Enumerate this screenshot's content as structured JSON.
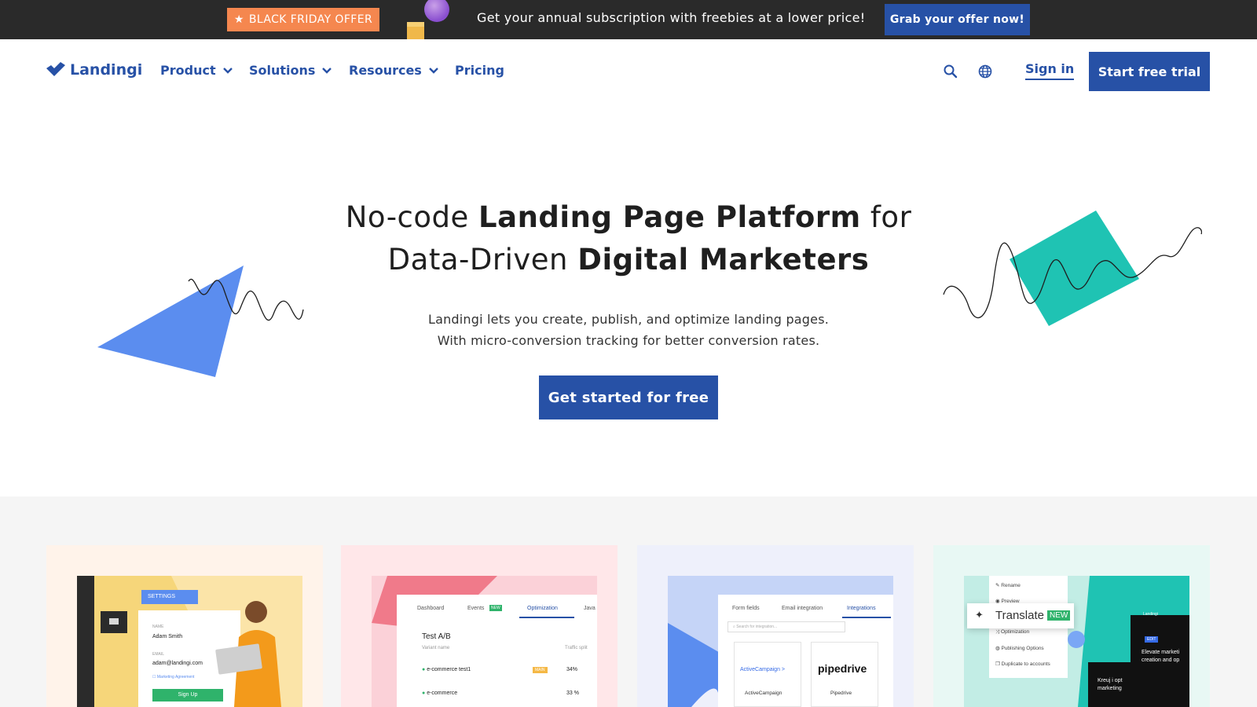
{
  "promo": {
    "badge": "BLACK FRIDAY OFFER",
    "text": "Get your annual subscription with freebies at a lower price!",
    "button": "Grab your offer now!"
  },
  "header": {
    "brand": "Landingi",
    "nav": [
      {
        "label": "Product"
      },
      {
        "label": "Solutions"
      },
      {
        "label": "Resources"
      },
      {
        "label": "Pricing"
      }
    ],
    "signin": "Sign in",
    "trial": "Start free trial"
  },
  "hero": {
    "title_pre": "No-code ",
    "title_bold1": "Landing Page Platform",
    "title_mid": " for",
    "title_line2_pre": "Data-Driven ",
    "title_bold2": "Digital Marketers",
    "sub1": "Landingi lets you create, publish, and optimize landing pages.",
    "sub2": "With micro-conversion tracking for better conversion rates.",
    "cta": "Get started for free"
  },
  "cards": {
    "editor": {
      "settings": "SETTINGS",
      "name_label": "NAME",
      "name_value": "Adam Smith",
      "email_label": "EMAIL",
      "email_value": "adam@landingi.com",
      "agreement": "Marketing Agreement",
      "signup": "Sign Up"
    },
    "ab": {
      "tabs": [
        "Dashboard",
        "Events",
        "Optimization",
        "Java"
      ],
      "events_badge": "NEW",
      "heading": "Test A/B",
      "variant_col": "Variant name",
      "split_col": "Traffic split",
      "rows": [
        {
          "name": "e-commerce test1",
          "badge": "MAIN",
          "split": "34%"
        },
        {
          "name": "e-commerce",
          "badge": "",
          "split": "33 %"
        }
      ]
    },
    "integrations": {
      "tabs": [
        "Form fields",
        "Email integration",
        "Integrations"
      ],
      "search": "Search for integration...",
      "items": [
        {
          "logo": "ActiveCampaign >",
          "name": "ActiveCampaign"
        },
        {
          "logo": "pipedrive",
          "name": "Pipedrive"
        }
      ]
    },
    "translate": {
      "menu": [
        "Rename",
        "Preview",
        "Optimization",
        "Publishing Options",
        "Duplicate to accounts"
      ],
      "translate": "Translate",
      "badge": "NEW",
      "brand": "Landingi",
      "text1": "Elevate marketi",
      "text2": "creation and op",
      "text3": "Kreuj i opt",
      "text4": "marketing",
      "edit": "EDIT"
    }
  },
  "colors": {
    "brand": "#2751a6",
    "promo_badge": "#f5874f",
    "promo_bg": "#2a2a2a",
    "band": "#f5f5f5",
    "triangle": "#5b8def",
    "diamond": "#1fc3b3"
  }
}
